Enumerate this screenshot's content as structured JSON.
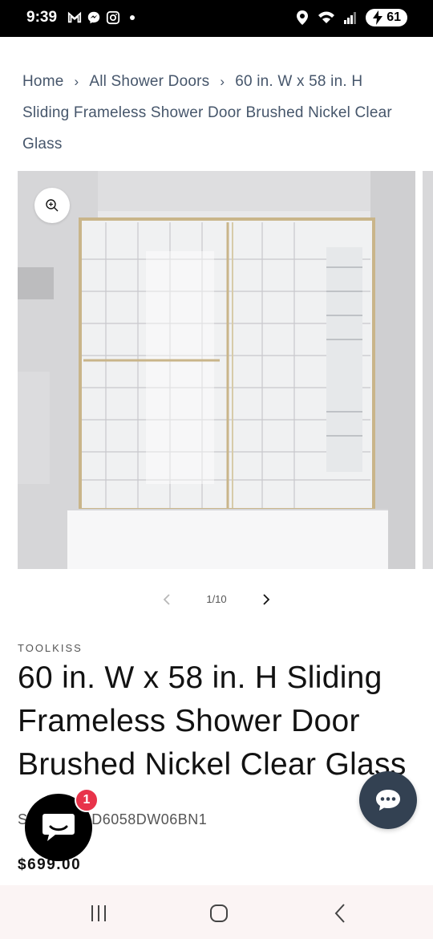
{
  "status_bar": {
    "time": "9:39",
    "battery": "61"
  },
  "breadcrumb": {
    "items": [
      "Home",
      "All Shower Doors",
      "60 in. W x 58 in. H Sliding Frameless Shower Door Brushed Nickel Clear Glass"
    ],
    "separator": "›"
  },
  "gallery": {
    "counter": "1/10",
    "current_index": 1,
    "total": 10
  },
  "product": {
    "vendor": "TOOLKISS",
    "title": "60 in. W x 58 in. H Sliding Frameless Shower Door Brushed Nickel Clear Glass",
    "sku": "SKU: TK-SD6058DW06BN1",
    "price": "$699.00"
  },
  "chat": {
    "badge_count": "1"
  },
  "colors": {
    "accent_dark": "#121212",
    "breadcrumb": "#46566b",
    "badge": "#e8334a",
    "support_chat": "#334152"
  },
  "icons": {
    "zoom": "zoom-in-icon",
    "prev": "chevron-left-icon",
    "next": "chevron-right-icon",
    "chat": "chat-bubble-icon"
  }
}
